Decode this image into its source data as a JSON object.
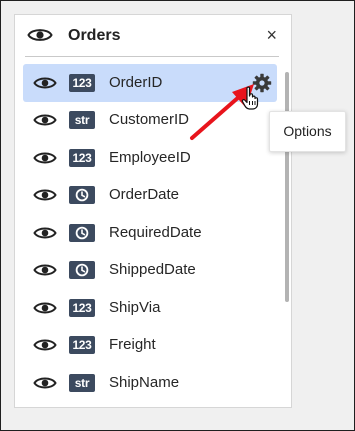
{
  "panel": {
    "title": "Orders",
    "close_glyph": "×",
    "header_icon": "eye-icon"
  },
  "fields": [
    {
      "name": "OrderID",
      "type": "number",
      "badge": "123",
      "selected": true,
      "visible": true
    },
    {
      "name": "CustomerID",
      "type": "string",
      "badge": "str",
      "selected": false,
      "visible": true
    },
    {
      "name": "EmployeeID",
      "type": "number",
      "badge": "123",
      "selected": false,
      "visible": true
    },
    {
      "name": "OrderDate",
      "type": "date",
      "badge": "clock-icon",
      "selected": false,
      "visible": true
    },
    {
      "name": "RequiredDate",
      "type": "date",
      "badge": "clock-icon",
      "selected": false,
      "visible": true
    },
    {
      "name": "ShippedDate",
      "type": "date",
      "badge": "clock-icon",
      "selected": false,
      "visible": true
    },
    {
      "name": "ShipVia",
      "type": "number",
      "badge": "123",
      "selected": false,
      "visible": true
    },
    {
      "name": "Freight",
      "type": "number",
      "badge": "123",
      "selected": false,
      "visible": true
    },
    {
      "name": "ShipName",
      "type": "string",
      "badge": "str",
      "selected": false,
      "visible": true
    }
  ],
  "tooltip": {
    "text": "Options"
  },
  "colors": {
    "selected_row": "#c9dcfb",
    "badge_bg": "#3c4a5f",
    "arrow": "#e8141c"
  }
}
